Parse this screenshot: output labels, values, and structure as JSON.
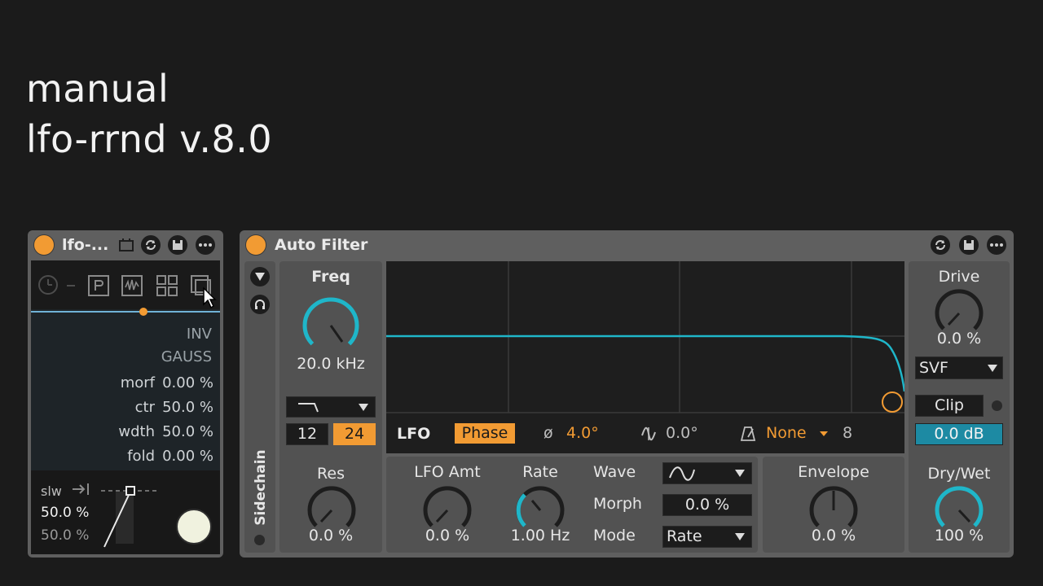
{
  "overlay": {
    "line1": "manual",
    "line2": "lfo-rrnd v.8.0"
  },
  "lfo_device": {
    "title": "lfo-...",
    "tabs": [
      {
        "icon": "clock-icon"
      },
      {
        "icon": "dash-icon"
      },
      {
        "icon": "p-box-icon"
      },
      {
        "icon": "waveform-icon"
      },
      {
        "icon": "grid-icon"
      },
      {
        "icon": "copy-icon"
      }
    ],
    "inv": "INV",
    "gauss": "GAUSS",
    "params": [
      {
        "label": "morf",
        "value": "0.00 %"
      },
      {
        "label": "ctr",
        "value": "50.0 %"
      },
      {
        "label": "wdth",
        "value": "50.0 %"
      },
      {
        "label": "fold",
        "value": "0.00 %"
      }
    ],
    "slw_label": "slw",
    "slw_value1": "50.0 %",
    "slw_value2": "50.0 %",
    "slider_level": 0.5
  },
  "auto_filter": {
    "title": "Auto Filter",
    "sidechain": "Sidechain",
    "freq": {
      "label": "Freq",
      "value": "20.0 kHz"
    },
    "filter_type_slopes": [
      "12",
      "24"
    ],
    "res": {
      "label": "Res",
      "value": "0.0 %"
    },
    "lfo_bar": {
      "lfo": "LFO",
      "phase": "Phase",
      "phase_symbol": "ø",
      "phase_value": "4.0°",
      "offset_value": "0.0°",
      "sync_value": "None",
      "sync_number": "8"
    },
    "lfo_amt": {
      "label": "LFO Amt",
      "value": "0.0 %"
    },
    "rate": {
      "label": "Rate",
      "value": "1.00 Hz"
    },
    "wave": {
      "label": "Wave"
    },
    "morph": {
      "label": "Morph",
      "value": "0.0 %"
    },
    "mode": {
      "label": "Mode",
      "value": "Rate"
    },
    "envelope": {
      "label": "Envelope",
      "value": "0.0 %"
    },
    "drive": {
      "label": "Drive",
      "value": "0.0 %"
    },
    "circuit": "SVF",
    "clip": "Clip",
    "clip_db": "0.0 dB",
    "drywet": {
      "label": "Dry/Wet",
      "value": "100 %"
    }
  },
  "colors": {
    "accent": "#f29b33",
    "cyan": "#1fb6c9",
    "panel": "#5f5f5f"
  }
}
